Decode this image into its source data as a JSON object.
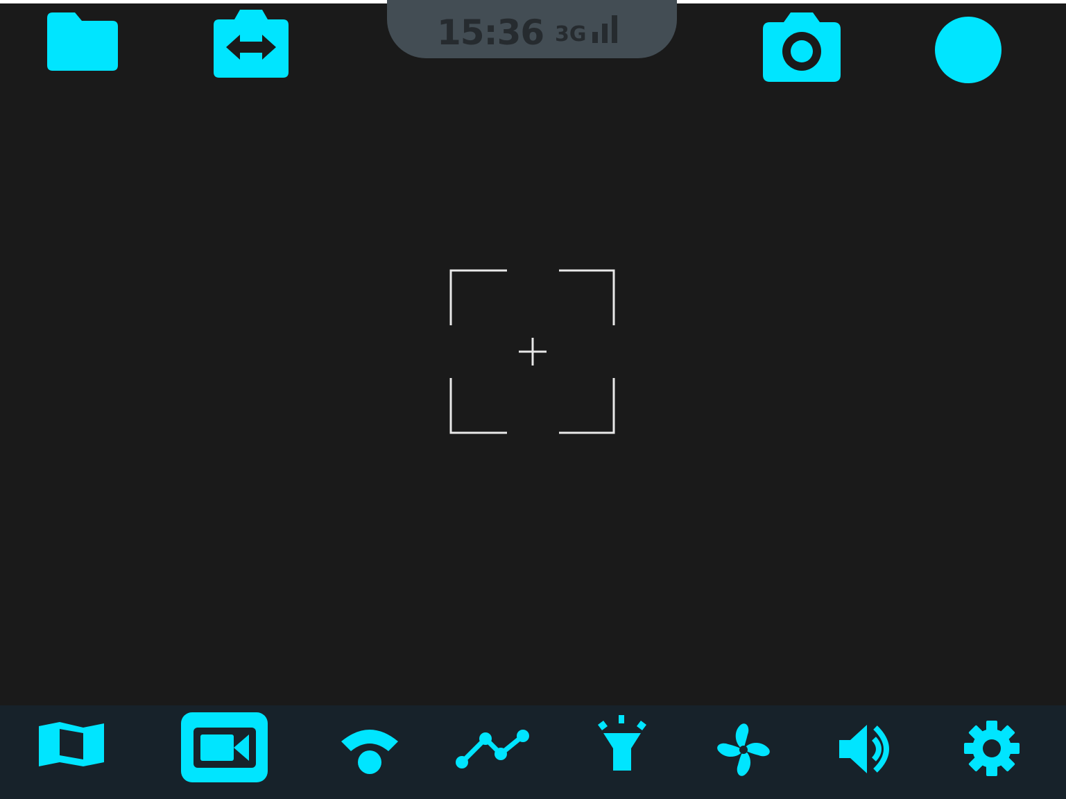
{
  "status_bar": {
    "time": "15:36",
    "network": "3G"
  },
  "colors": {
    "accent": "#00e5ff",
    "background": "#1a1a1a",
    "bottom_bar": "#17222a",
    "status_pill": "#434d54"
  },
  "top_controls": {
    "left": [
      "folder-icon",
      "switch-camera-icon"
    ],
    "right": [
      "camera-icon",
      "record-icon"
    ]
  },
  "bottom_nav": {
    "items": [
      "map-icon",
      "video-camera-icon",
      "wifi-icon",
      "chart-line-icon",
      "flashlight-icon",
      "fan-icon",
      "volume-icon",
      "settings-icon"
    ],
    "active": "video-camera-icon"
  }
}
